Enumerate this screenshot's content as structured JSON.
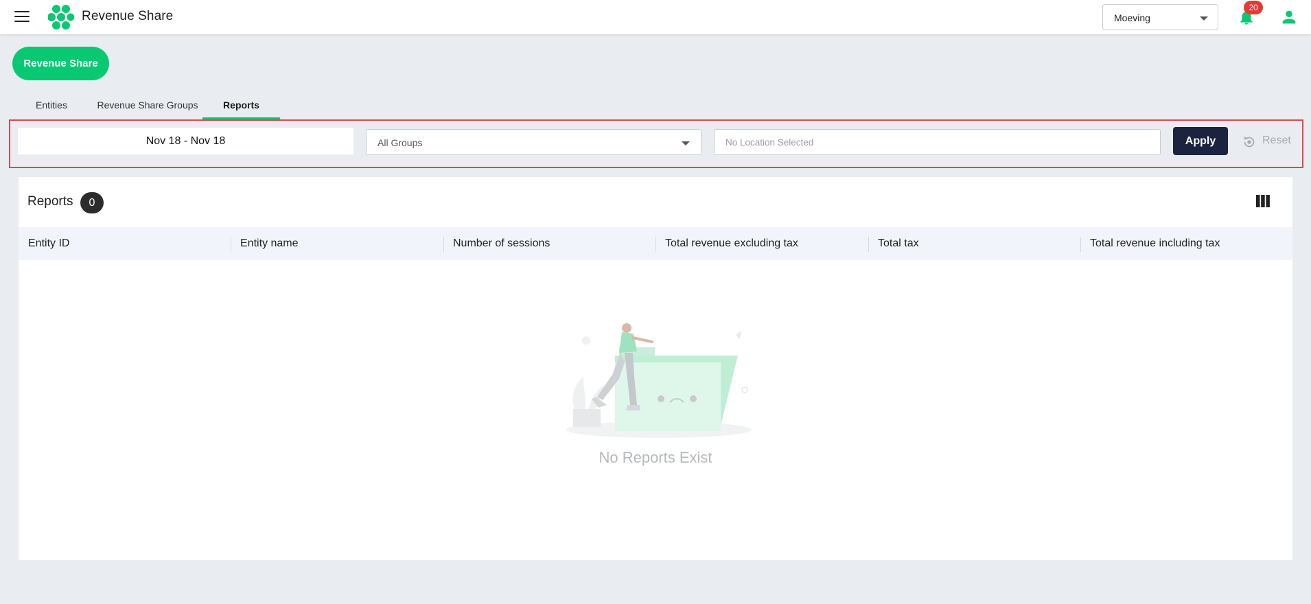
{
  "header": {
    "title": "Revenue Share",
    "org_select": "Moeving",
    "notifications_count": "20",
    "colors": {
      "brand": "#08c972",
      "badge": "#e53935"
    }
  },
  "page_button": "Revenue Share",
  "tabs": [
    {
      "label": "Entities",
      "active": false
    },
    {
      "label": "Revenue Share Groups",
      "active": false
    },
    {
      "label": "Reports",
      "active": true
    }
  ],
  "filters": {
    "date_range": "Nov 18 - Nov 18",
    "group": "All Groups",
    "location_placeholder": "No Location Selected",
    "apply_label": "Apply",
    "reset_label": "Reset",
    "colors": {
      "apply_bg": "#1c2340",
      "highlight_border": "#e04848"
    }
  },
  "reports": {
    "title": "Reports",
    "count": "0",
    "columns": [
      "Entity ID",
      "Entity name",
      "Number of sessions",
      "Total revenue excluding tax",
      "Total tax",
      "Total revenue including tax"
    ],
    "empty_message": "No Reports Exist"
  }
}
